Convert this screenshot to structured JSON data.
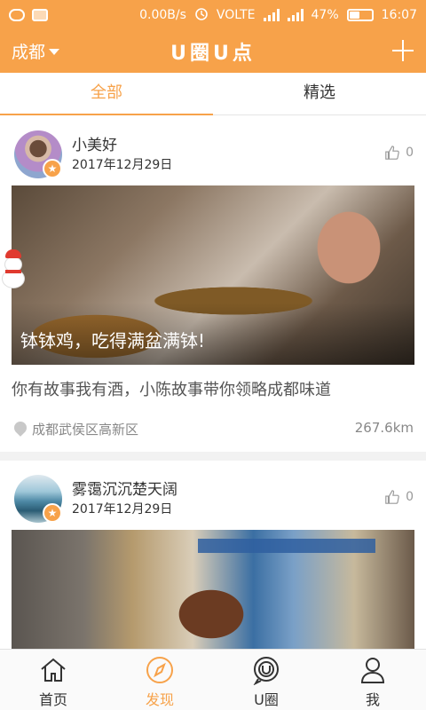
{
  "status_bar": {
    "net_speed": "0.00B/s",
    "volte": "VOLTE",
    "battery": "47%",
    "time": "16:07",
    "icons": [
      "wechat-icon",
      "notification-icon",
      "alarm-icon",
      "signal-icon",
      "battery-icon"
    ]
  },
  "header": {
    "city": "成都",
    "title": "U圈U点",
    "add_icon": "plus-icon"
  },
  "tabs": [
    {
      "label": "全部",
      "active": true
    },
    {
      "label": "精选",
      "active": false
    }
  ],
  "posts": [
    {
      "user": "小美好",
      "date": "2017年12月29日",
      "likes": "0",
      "caption": "钵钵鸡，吃得满盆满钵!",
      "description": "你有故事我有酒，小陈故事带你领略成都味道",
      "location": "成都武侯区高新区",
      "distance": "267.6km"
    },
    {
      "user": "雾霭沉沉楚天阔",
      "date": "2017年12月29日",
      "likes": "0"
    }
  ],
  "nav": [
    {
      "label": "首页",
      "icon": "home-icon",
      "active": false
    },
    {
      "label": "发现",
      "icon": "compass-icon",
      "active": true
    },
    {
      "label": "U圈",
      "icon": "u-circle-icon",
      "active": false
    },
    {
      "label": "我",
      "icon": "profile-icon",
      "active": false
    }
  ],
  "colors": {
    "accent": "#f7a24a",
    "text": "#333333",
    "muted": "#888888"
  }
}
